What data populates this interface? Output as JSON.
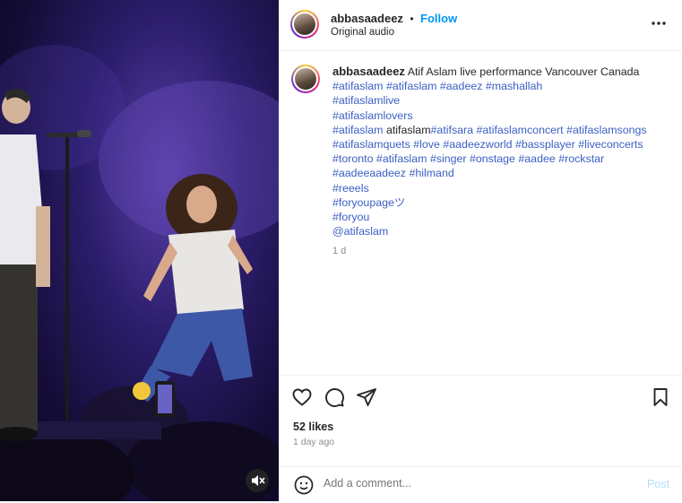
{
  "post": {
    "username": "abbasaadeez",
    "separator": "•",
    "follow_label": "Follow",
    "audio": "Original audio"
  },
  "caption": {
    "username": "abbasaadeez",
    "text": "Atif Aslam live performance Vancouver Canada",
    "lines": [
      [
        {
          "t": "#atifaslam",
          "tag": true
        },
        {
          "t": " ",
          "tag": false
        },
        {
          "t": "#atifaslam",
          "tag": true
        },
        {
          "t": " ",
          "tag": false
        },
        {
          "t": "#aadeez",
          "tag": true
        },
        {
          "t": " ",
          "tag": false
        },
        {
          "t": "#mashallah",
          "tag": true
        }
      ],
      [
        {
          "t": "#atifaslamlive",
          "tag": true
        }
      ],
      [
        {
          "t": "#atifaslamlovers",
          "tag": true
        }
      ],
      [
        {
          "t": "#atifaslam",
          "tag": true
        },
        {
          "t": " ",
          "tag": false
        },
        {
          "t": "atifaslam",
          "tag": false
        },
        {
          "t": "#atifsara",
          "tag": true
        },
        {
          "t": " ",
          "tag": false
        },
        {
          "t": "#atifaslamconcert",
          "tag": true
        },
        {
          "t": " ",
          "tag": false
        },
        {
          "t": "#atifaslamsongs",
          "tag": true
        }
      ],
      [
        {
          "t": "#atifaslamquets",
          "tag": true
        },
        {
          "t": " ",
          "tag": false
        },
        {
          "t": "#love",
          "tag": true
        },
        {
          "t": " ",
          "tag": false
        },
        {
          "t": "#aadeezworld",
          "tag": true
        },
        {
          "t": " ",
          "tag": false
        },
        {
          "t": "#bassplayer",
          "tag": true
        },
        {
          "t": " ",
          "tag": false
        },
        {
          "t": "#liveconcerts",
          "tag": true
        }
      ],
      [
        {
          "t": "#toronto",
          "tag": true
        },
        {
          "t": " ",
          "tag": false
        },
        {
          "t": "#atifaslam",
          "tag": true
        },
        {
          "t": " ",
          "tag": false
        },
        {
          "t": "#singer",
          "tag": true
        },
        {
          "t": " ",
          "tag": false
        },
        {
          "t": "#onstage",
          "tag": true
        },
        {
          "t": " ",
          "tag": false
        },
        {
          "t": "#aadee",
          "tag": true
        },
        {
          "t": " ",
          "tag": false
        },
        {
          "t": "#rockstar",
          "tag": true
        }
      ],
      [
        {
          "t": "#aadeeaadeez",
          "tag": true
        },
        {
          "t": " ",
          "tag": false
        },
        {
          "t": "#hilmand",
          "tag": true
        }
      ],
      [
        {
          "t": "#reeels",
          "tag": true
        }
      ],
      [
        {
          "t": "#foryoupageツ",
          "tag": true
        }
      ],
      [
        {
          "t": "#foryou",
          "tag": true
        }
      ],
      [
        {
          "t": "@atifaslam",
          "tag": true
        }
      ]
    ],
    "time": "1 d"
  },
  "stats": {
    "likes": "52 likes",
    "ago": "1 day ago"
  },
  "comment": {
    "placeholder": "Add a comment...",
    "post_label": "Post"
  },
  "colors": {
    "link": "#3b5fc4",
    "follow": "#0095f6",
    "post_disabled": "#b2dffc"
  },
  "icons": [
    "more-options-icon",
    "heart-icon",
    "comment-icon",
    "share-icon",
    "bookmark-icon",
    "emoji-icon",
    "mute-icon"
  ]
}
